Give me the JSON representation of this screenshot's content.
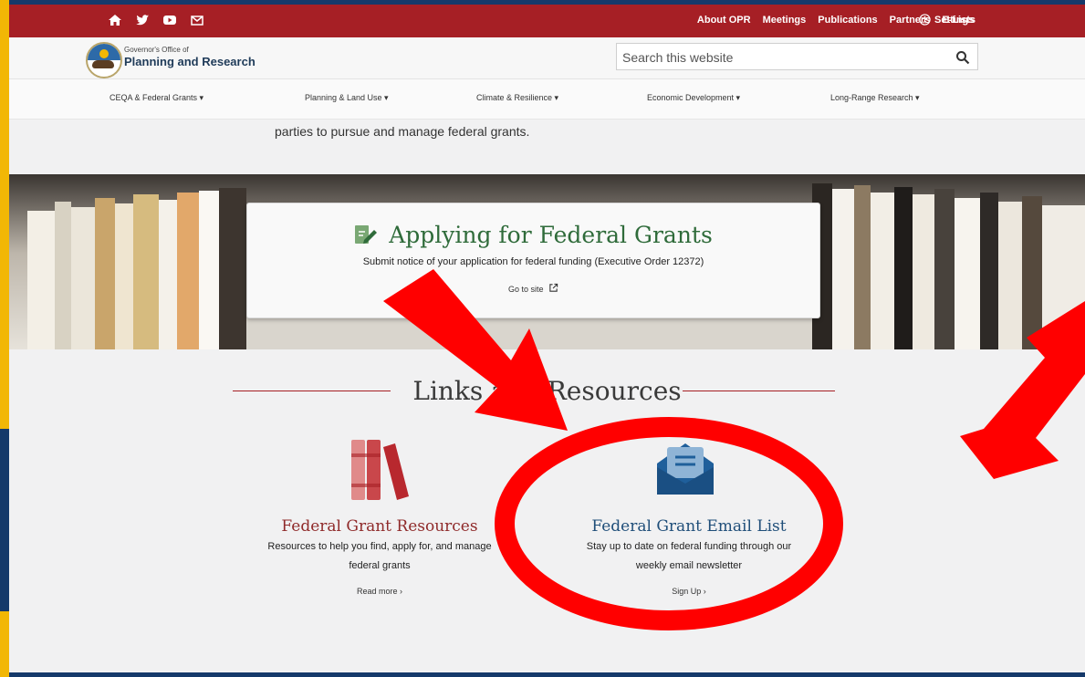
{
  "topbar": {
    "links": [
      "About OPR",
      "Meetings",
      "Publications",
      "Partners",
      "E-Lists"
    ],
    "settings_label": "Settings"
  },
  "brand": {
    "small": "Governor's Office of",
    "name": "Planning and Research"
  },
  "search": {
    "placeholder": "Search this website"
  },
  "nav": {
    "items": [
      "CEQA & Federal Grants ▾",
      "Planning & Land Use ▾",
      "Climate & Resilience ▾",
      "Economic Development ▾",
      "Long-Range Research ▾"
    ]
  },
  "intro": {
    "text": "parties to pursue and manage federal grants."
  },
  "feature_card": {
    "title": "Applying for Federal Grants",
    "description": "Submit notice of your application for federal funding (Executive Order 12372)",
    "link_label": "Go to site"
  },
  "resources": {
    "heading": "Links and Resources",
    "items": [
      {
        "title": "Federal Grant Resources",
        "desc_line1": "Resources to help you find, apply for, and manage",
        "desc_line2": "federal grants",
        "link_label": "Read more ›"
      },
      {
        "title": "Federal Grant Email List",
        "desc_line1": "Stay up to date on federal funding through our",
        "desc_line2": "weekly email newsletter",
        "link_label": "Sign Up ›"
      }
    ]
  },
  "colors": {
    "brand_red": "#a61f25",
    "green_title": "#2f6b3a",
    "blue_title": "#1f4e79",
    "annotation_red": "#ff0000"
  }
}
